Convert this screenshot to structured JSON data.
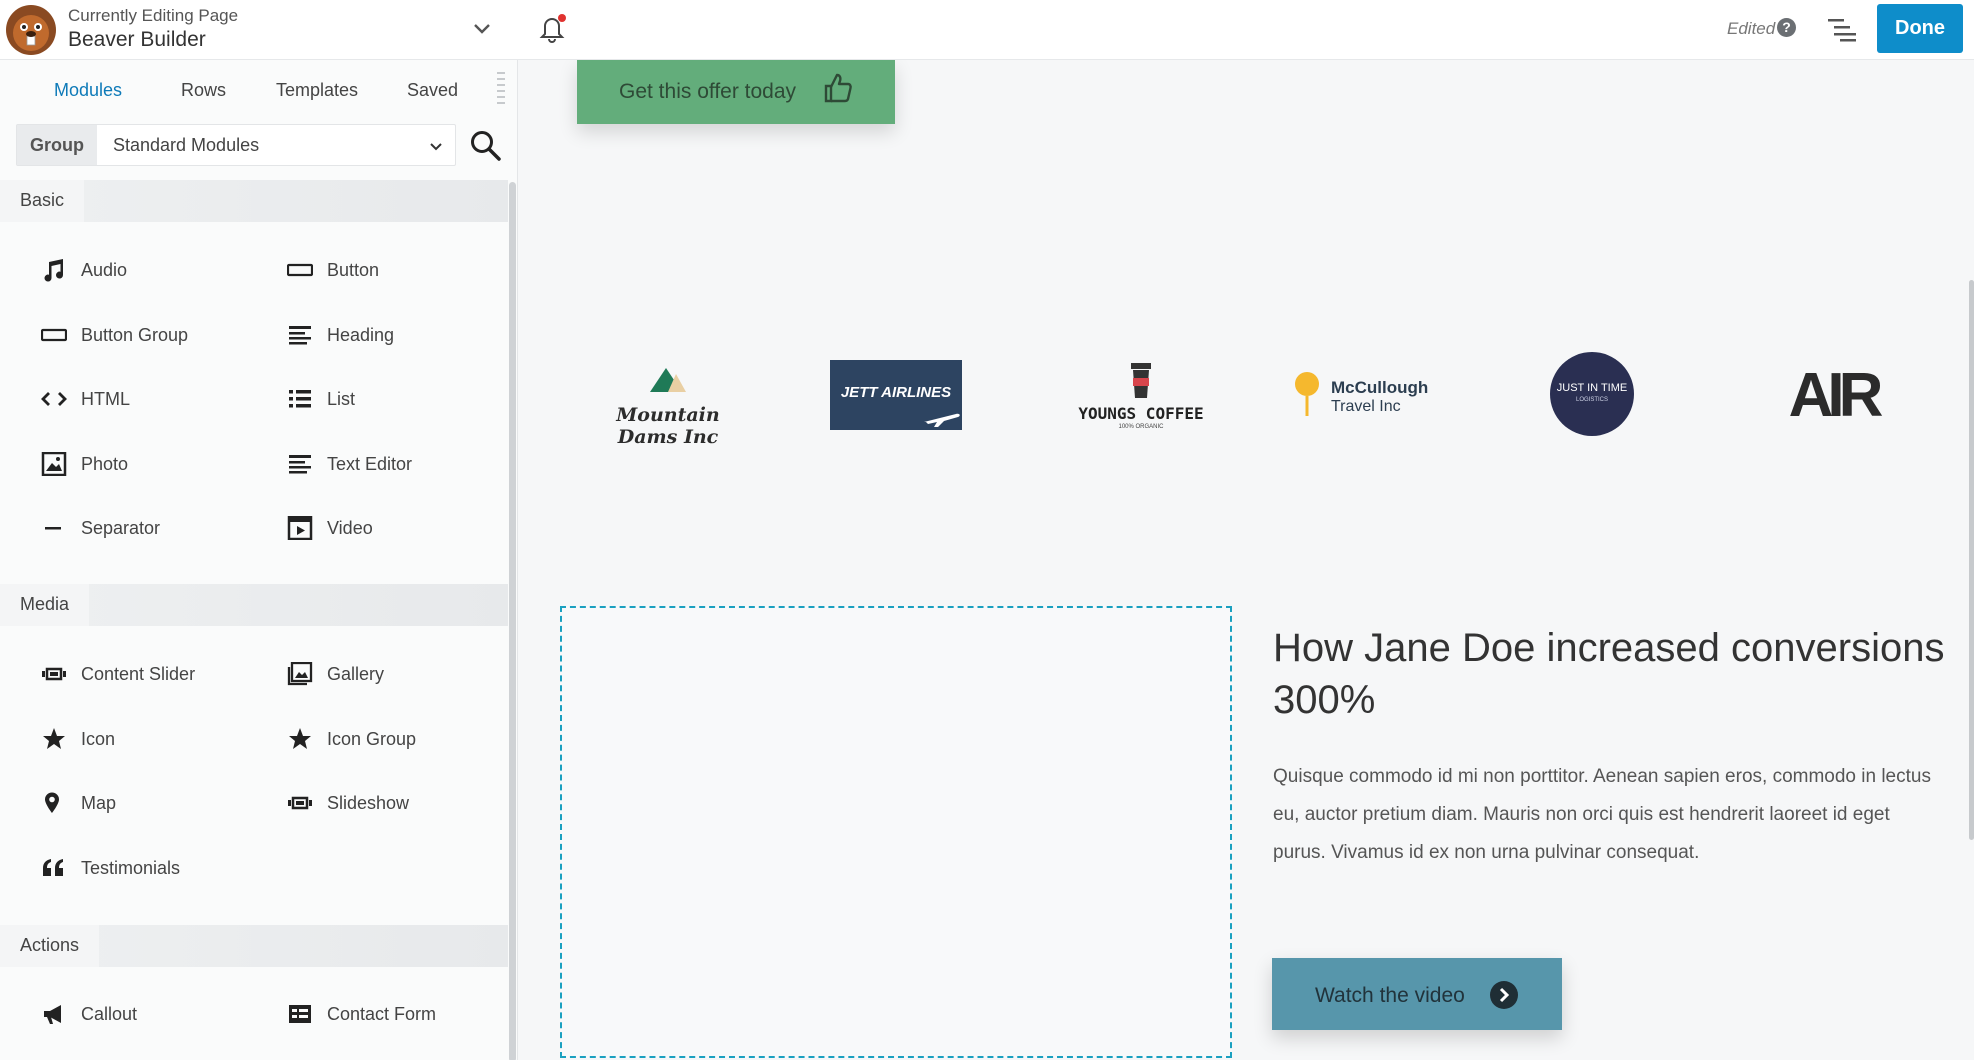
{
  "header": {
    "editing_caption": "Currently Editing Page",
    "page_title": "Beaver Builder",
    "status": "Edited",
    "help_glyph": "?",
    "done_label": "Done",
    "brand_icon": "beaver-logo-icon",
    "notification_color": "#e0322f"
  },
  "sidebar": {
    "tabs": [
      {
        "label": "Modules",
        "active": true
      },
      {
        "label": "Rows",
        "active": false
      },
      {
        "label": "Templates",
        "active": false
      },
      {
        "label": "Saved",
        "active": false
      }
    ],
    "group_label": "Group",
    "group_value": "Standard Modules",
    "sections": [
      {
        "title": "Basic",
        "modules": [
          {
            "label": "Audio",
            "icon": "music-note-icon"
          },
          {
            "label": "Button",
            "icon": "button-icon"
          },
          {
            "label": "Button Group",
            "icon": "button-group-icon"
          },
          {
            "label": "Heading",
            "icon": "heading-icon"
          },
          {
            "label": "HTML",
            "icon": "code-icon"
          },
          {
            "label": "List",
            "icon": "list-icon"
          },
          {
            "label": "Photo",
            "icon": "photo-icon"
          },
          {
            "label": "Text Editor",
            "icon": "text-editor-icon"
          },
          {
            "label": "Separator",
            "icon": "separator-icon"
          },
          {
            "label": "Video",
            "icon": "video-icon"
          }
        ]
      },
      {
        "title": "Media",
        "modules": [
          {
            "label": "Content Slider",
            "icon": "content-slider-icon"
          },
          {
            "label": "Gallery",
            "icon": "gallery-icon"
          },
          {
            "label": "Icon",
            "icon": "star-icon"
          },
          {
            "label": "Icon Group",
            "icon": "star-icon"
          },
          {
            "label": "Map",
            "icon": "map-pin-icon"
          },
          {
            "label": "Slideshow",
            "icon": "slideshow-icon"
          },
          {
            "label": "Testimonials",
            "icon": "quote-icon"
          }
        ]
      },
      {
        "title": "Actions",
        "modules": [
          {
            "label": "Callout",
            "icon": "megaphone-icon"
          },
          {
            "label": "Contact Form",
            "icon": "form-icon"
          }
        ]
      }
    ]
  },
  "canvas": {
    "offer_button": "Get this offer today",
    "logos": {
      "mountain": "Mountain Dams Inc",
      "jett": "JETT AIRLINES",
      "youngs": "YOUNGS COFFEE",
      "youngs_sub": "100% ORGANIC",
      "mccullough_line1": "McCullough",
      "mccullough_line2": "Travel Inc",
      "jit_line1": "JUST IN TIME",
      "jit_line2": "LOGISTICS",
      "air": "AIR"
    },
    "case_title": "How Jane Doe increased conversions 300%",
    "case_body": "Quisque commodo id mi non porttitor. Aenean sapien eros, commodo in lectus eu, auctor pretium diam. Mauris non orci quis est hendrerit laoreet id eget purus. Vivamus id ex non urna pulvinar consequat.",
    "watch_button": "Watch the video",
    "colors": {
      "offer": "#63ad7b",
      "watch": "#5796ab",
      "accent": "#0e8dca",
      "dashed": "#1aa0c0"
    }
  }
}
